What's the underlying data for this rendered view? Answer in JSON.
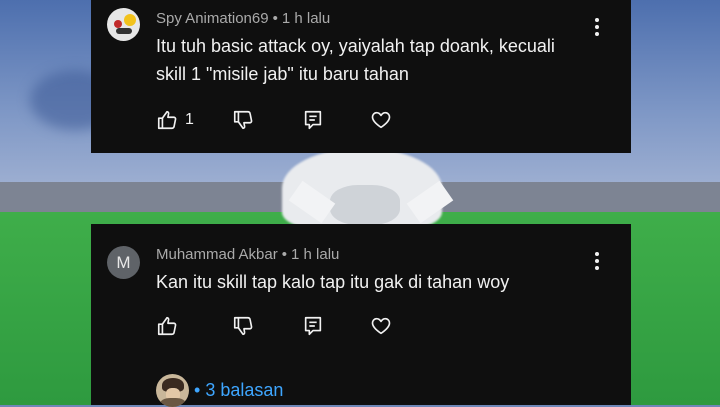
{
  "comments": [
    {
      "author": "Spy Animation69",
      "time": "1 h lalu",
      "text_line1": "Itu tuh basic attack oy, yaiyalah tap doank,  kecuali",
      "text_line2": "skill 1 \"misile jab\" itu baru tahan",
      "like_count": "1"
    },
    {
      "avatar_letter": "M",
      "author": "Muhammad Akbar",
      "time": "1 h lalu",
      "text_line1": "Kan itu skill tap kalo tap itu gak di tahan woy",
      "replies_label": "3 balasan"
    }
  ],
  "separator": "•",
  "colors": {
    "card_bg": "#0f0f0f",
    "text_primary": "#f1f1f1",
    "text_meta": "#aaaaaa",
    "link": "#3ea6ff"
  },
  "icons": [
    "thumbs-up-icon",
    "thumbs-down-icon",
    "reply-icon",
    "heart-icon",
    "more-vert-icon"
  ]
}
